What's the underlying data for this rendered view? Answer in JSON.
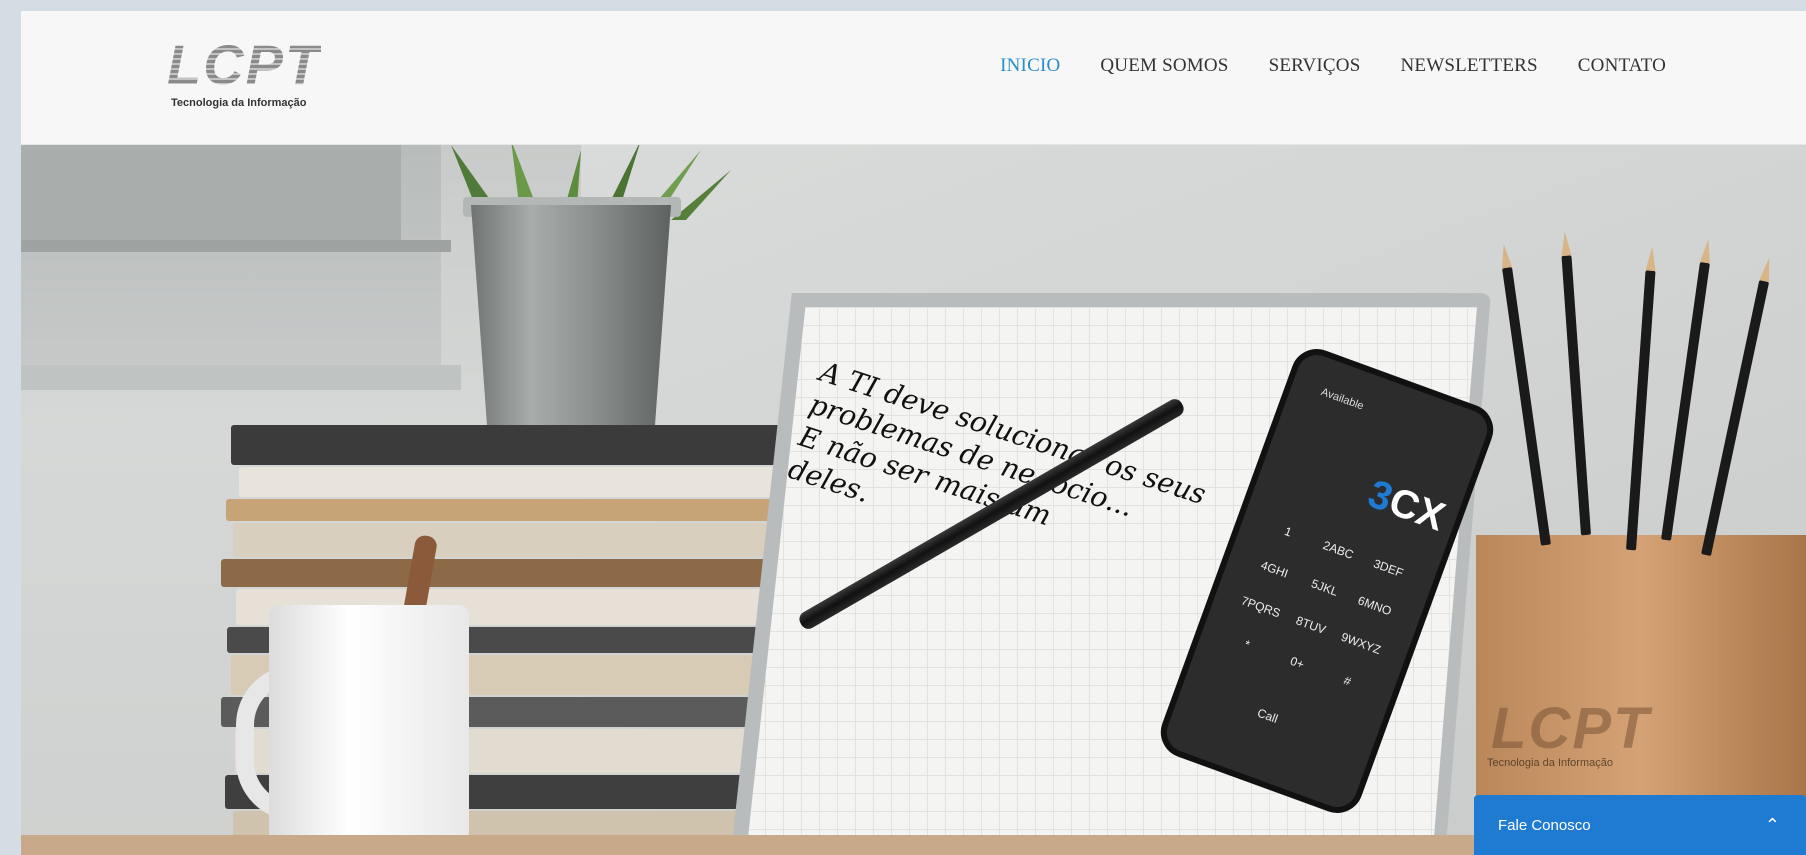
{
  "brand": {
    "logo_text": "LCPT",
    "tagline": "Tecnologia da Informação"
  },
  "nav": {
    "items": [
      {
        "label": "INICIO",
        "active": true
      },
      {
        "label": "QUEM SOMOS",
        "active": false
      },
      {
        "label": "SERVIÇOS",
        "active": false
      },
      {
        "label": "NEWSLETTERS",
        "active": false
      },
      {
        "label": "CONTATO",
        "active": false
      }
    ],
    "active_color": "#2b8ccc"
  },
  "hero": {
    "handwriting_lines": [
      "A TI deve solucionar os seus",
      "problemas de negócio...",
      "E não ser mais um",
      "deles."
    ],
    "phone": {
      "status": "Available",
      "brand_num": "3",
      "brand_text": "CX",
      "keys": [
        "1",
        "2ABC",
        "3DEF",
        "4GHI",
        "5JKL",
        "6MNO",
        "7PQRS",
        "8TUV",
        "9WXYZ",
        "*",
        "0+",
        "#"
      ],
      "call_label": "Call"
    },
    "holder_logo": "LCPT",
    "holder_tagline": "Tecnologia da Informação"
  },
  "chat": {
    "label": "Fale Conosco",
    "icon": "chevron-up-icon",
    "color": "#1f7ad2"
  }
}
